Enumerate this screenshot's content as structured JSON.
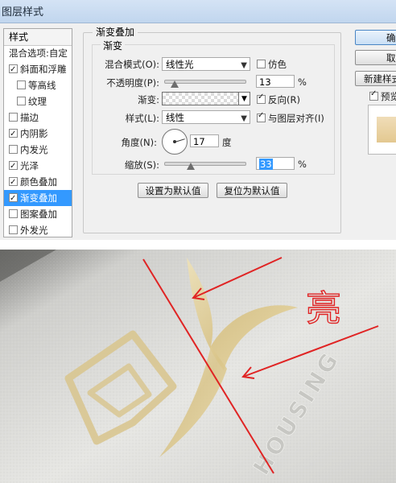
{
  "window": {
    "title": "图层样式"
  },
  "styles_panel": {
    "header": "样式",
    "items": [
      {
        "label": "混合选项:自定",
        "checkbox": null,
        "selected": false,
        "indent": false
      },
      {
        "label": "斜面和浮雕",
        "checkbox": true,
        "selected": false,
        "indent": false
      },
      {
        "label": "等高线",
        "checkbox": false,
        "selected": false,
        "indent": true
      },
      {
        "label": "纹理",
        "checkbox": false,
        "selected": false,
        "indent": true
      },
      {
        "label": "描边",
        "checkbox": false,
        "selected": false,
        "indent": false
      },
      {
        "label": "内阴影",
        "checkbox": true,
        "selected": false,
        "indent": false
      },
      {
        "label": "内发光",
        "checkbox": false,
        "selected": false,
        "indent": false
      },
      {
        "label": "光泽",
        "checkbox": true,
        "selected": false,
        "indent": false
      },
      {
        "label": "颜色叠加",
        "checkbox": true,
        "selected": false,
        "indent": false
      },
      {
        "label": "渐变叠加",
        "checkbox": true,
        "selected": true,
        "indent": false
      },
      {
        "label": "图案叠加",
        "checkbox": false,
        "selected": false,
        "indent": false
      },
      {
        "label": "外发光",
        "checkbox": false,
        "selected": false,
        "indent": false
      }
    ]
  },
  "gradient_overlay": {
    "group_title": "渐变叠加",
    "sub_title": "渐变",
    "blend_mode_label": "混合模式(O):",
    "blend_mode_value": "线性光",
    "dither_label": "仿色",
    "dither_checked": false,
    "opacity_label": "不透明度(P):",
    "opacity_value": "13",
    "opacity_unit": "%",
    "opacity_fraction": 0.13,
    "gradient_label": "渐变:",
    "reverse_label": "反向(R)",
    "reverse_checked": true,
    "style_label": "样式(L):",
    "style_value": "线性",
    "align_label": "与图层对齐(I)",
    "align_checked": true,
    "angle_label": "角度(N):",
    "angle_value": "17",
    "angle_unit": "度",
    "scale_label": "缩放(S):",
    "scale_value": "33",
    "scale_unit": "%",
    "scale_fraction": 0.33,
    "default_button": "设置为默认值",
    "reset_button": "复位为默认值"
  },
  "right_buttons": {
    "ok": "确定",
    "cancel": "取消",
    "new_style": "新建样式",
    "preview_label": "预览",
    "preview_checked": true
  },
  "photo": {
    "annotation_text": "亮",
    "logo_text": "HOUSING",
    "annotation_color": "#e02424",
    "foil_color": "#d8c48c"
  }
}
